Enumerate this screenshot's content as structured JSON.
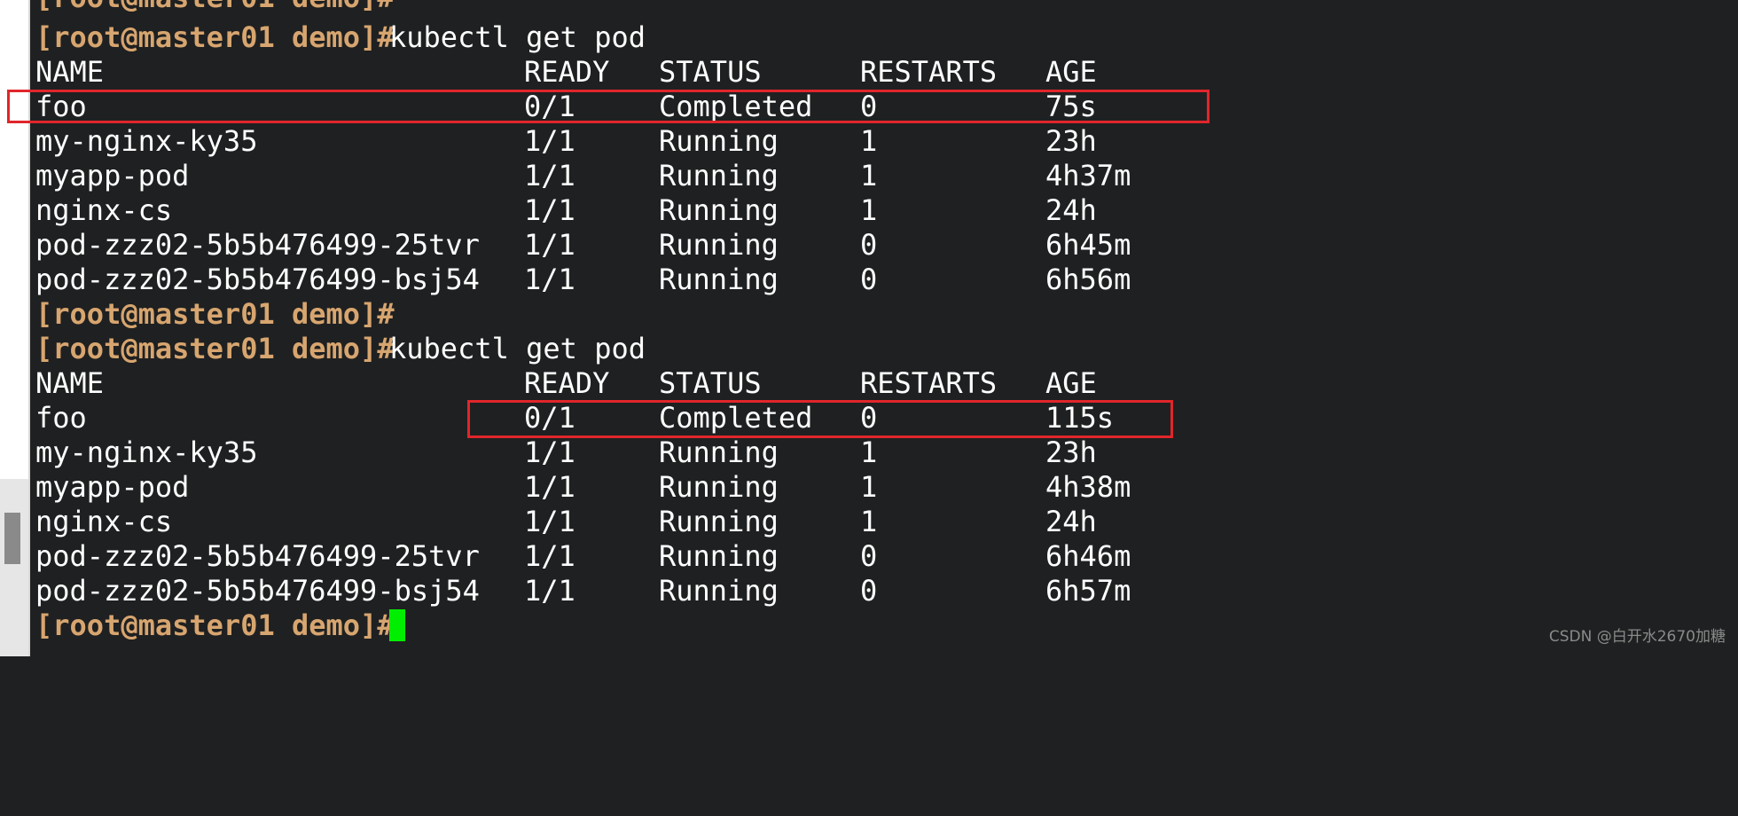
{
  "terminal": {
    "prompt_partial": "[root@master01 demo]#",
    "prompt": "[root@master01 demo]#",
    "command": "kubectl get pod",
    "headers": {
      "name": "NAME",
      "ready": "READY",
      "status": "STATUS",
      "restarts": "RESTARTS",
      "age": "AGE"
    },
    "first_output": [
      {
        "name": "foo",
        "ready": "0/1",
        "status": "Completed",
        "restarts": "0",
        "age": "75s"
      },
      {
        "name": "my-nginx-ky35",
        "ready": "1/1",
        "status": "Running",
        "restarts": "1",
        "age": "23h"
      },
      {
        "name": "myapp-pod",
        "ready": "1/1",
        "status": "Running",
        "restarts": "1",
        "age": "4h37m"
      },
      {
        "name": "nginx-cs",
        "ready": "1/1",
        "status": "Running",
        "restarts": "1",
        "age": "24h"
      },
      {
        "name": "pod-zzz02-5b5b476499-25tvr",
        "ready": "1/1",
        "status": "Running",
        "restarts": "0",
        "age": "6h45m"
      },
      {
        "name": "pod-zzz02-5b5b476499-bsj54",
        "ready": "1/1",
        "status": "Running",
        "restarts": "0",
        "age": "6h56m"
      }
    ],
    "second_output": [
      {
        "name": "foo",
        "ready": "0/1",
        "status": "Completed",
        "restarts": "0",
        "age": "115s"
      },
      {
        "name": "my-nginx-ky35",
        "ready": "1/1",
        "status": "Running",
        "restarts": "1",
        "age": "23h"
      },
      {
        "name": "myapp-pod",
        "ready": "1/1",
        "status": "Running",
        "restarts": "1",
        "age": "4h38m"
      },
      {
        "name": "nginx-cs",
        "ready": "1/1",
        "status": "Running",
        "restarts": "1",
        "age": "24h"
      },
      {
        "name": "pod-zzz02-5b5b476499-25tvr",
        "ready": "1/1",
        "status": "Running",
        "restarts": "0",
        "age": "6h46m"
      },
      {
        "name": "pod-zzz02-5b5b476499-bsj54",
        "ready": "1/1",
        "status": "Running",
        "restarts": "0",
        "age": "6h57m"
      }
    ]
  },
  "colors": {
    "background": "#1f2021",
    "prompt": "#d7a56f",
    "text": "#ffffff",
    "cursor": "#00ee00",
    "highlight": "#e0262b"
  },
  "watermark": "CSDN @白开水2670加糖"
}
